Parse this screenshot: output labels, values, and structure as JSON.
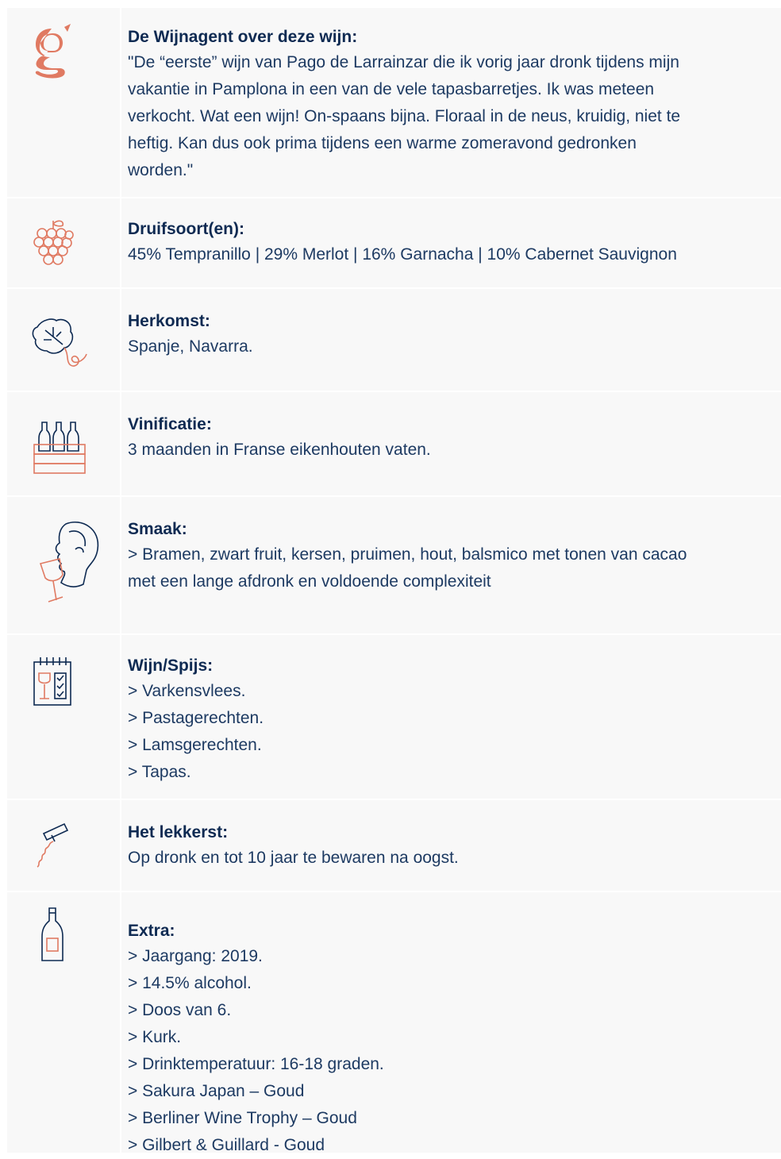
{
  "colors": {
    "accent": "#e07a62",
    "navy": "#0e2a52",
    "background": "#f8f8f8"
  },
  "sections": [
    {
      "icon": "wijnagent-g-logo-icon",
      "title": "De Wijnagent over deze wijn:",
      "lines": [
        "\"De “eerste” wijn van Pago de Larrainzar die ik vorig jaar dronk tijdens mijn",
        "vakantie in Pamplona in een van de vele tapasbarretjes. Ik was meteen",
        "verkocht. Wat een wijn! On-spaans bijna. Floraal in de neus, kruidig, niet te",
        "heftig. Kan dus ook prima tijdens een warme zomeravond gedronken",
        "worden.\""
      ]
    },
    {
      "icon": "grapes-icon",
      "title": "Druifsoort(en):",
      "lines": [
        "45% Tempranillo | 29% Merlot | 16% Garnacha | 10% Cabernet Sauvignon"
      ]
    },
    {
      "icon": "vine-leaf-icon",
      "title": "Herkomst:",
      "lines": [
        "Spanje, Navarra."
      ]
    },
    {
      "icon": "wine-crate-icon",
      "title": "Vinificatie:",
      "lines": [
        "3 maanden in Franse eikenhouten vaten."
      ]
    },
    {
      "icon": "tasting-face-icon",
      "title": "Smaak:",
      "lines": [
        "> Bramen, zwart fruit, kersen, pruimen, hout, balsmico met tonen van cacao",
        "met een lange afdronk en voldoende complexiteit"
      ]
    },
    {
      "icon": "wine-menu-icon",
      "title": "Wijn/Spijs:",
      "lines": [
        "> Varkensvlees.",
        "> Pastagerechten.",
        "> Lamsgerechten.",
        "> Tapas."
      ]
    },
    {
      "icon": "corkscrew-icon",
      "title": "Het lekkerst:",
      "lines": [
        "Op dronk en tot 10 jaar te bewaren na oogst."
      ]
    },
    {
      "icon": "wine-bottle-icon",
      "title": "Extra:",
      "lines": [
        "> Jaargang: 2019.",
        "> 14.5% alcohol.",
        "> Doos van 6.",
        "> Kurk.",
        "> Drinktemperatuur: 16-18 graden.",
        "> Sakura Japan – Goud",
        "> Berliner Wine Trophy – Goud",
        "> Gilbert & Guillard - Goud"
      ]
    }
  ]
}
